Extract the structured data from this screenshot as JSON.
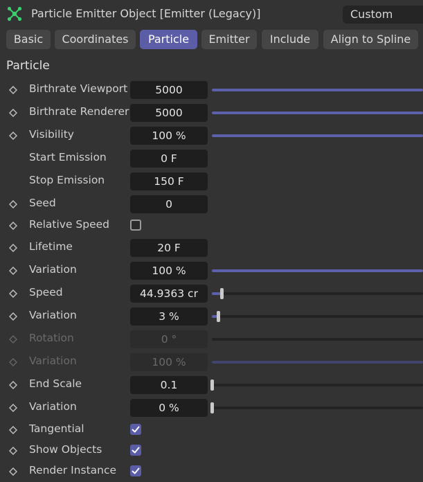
{
  "header": {
    "title": "Particle Emitter Object [Emitter (Legacy)]",
    "mode": "Custom",
    "icon": "particle-emitter-icon"
  },
  "tabs": [
    {
      "label": "Basic",
      "active": false
    },
    {
      "label": "Coordinates",
      "active": false
    },
    {
      "label": "Particle",
      "active": true
    },
    {
      "label": "Emitter",
      "active": false
    },
    {
      "label": "Include",
      "active": false
    },
    {
      "label": "Align to Spline",
      "active": false
    }
  ],
  "section": {
    "title": "Particle"
  },
  "params": [
    {
      "label": "Birthrate Viewport",
      "value": "5000",
      "keyframe": true,
      "slider": 1.0
    },
    {
      "label": "Birthrate Renderer",
      "value": "5000",
      "keyframe": true,
      "slider": 1.0
    },
    {
      "label": "Visibility",
      "value": "100 %",
      "keyframe": true,
      "slider": 1.0
    },
    {
      "label": "Start Emission",
      "value": "0 F",
      "keyframe": false
    },
    {
      "label": "Stop Emission",
      "value": "150 F",
      "keyframe": false
    },
    {
      "label": "Seed",
      "value": "0",
      "keyframe": true
    },
    {
      "label": "Relative Speed",
      "keyframe": true,
      "checkbox": false
    },
    {
      "label": "Lifetime",
      "value": "20 F",
      "keyframe": true
    },
    {
      "label": "Variation",
      "value": "100 %",
      "keyframe": true,
      "slider": 1.0
    },
    {
      "label": "Speed",
      "value": "44.9363 cr",
      "keyframe": true,
      "slider": 0.045,
      "knob": true
    },
    {
      "label": "Variation",
      "value": "3 %",
      "keyframe": true,
      "slider": 0.03,
      "knob": true
    },
    {
      "label": "Rotation",
      "value": "0 °",
      "keyframe": true,
      "disabled": true,
      "slider": 0
    },
    {
      "label": "Variation",
      "value": "100 %",
      "keyframe": true,
      "disabled": true,
      "slider": 1.0
    },
    {
      "label": "End Scale",
      "value": "0.1",
      "keyframe": true,
      "slider": 0,
      "knob": true
    },
    {
      "label": "Variation",
      "value": "0 %",
      "keyframe": true,
      "slider": 0,
      "knob": true
    },
    {
      "label": "Tangential",
      "keyframe": true,
      "checkbox": true
    },
    {
      "label": "Show Objects",
      "keyframe": true,
      "checkbox": true
    },
    {
      "label": "Render Instance",
      "keyframe": true,
      "checkbox": true
    }
  ],
  "colors": {
    "accent": "#5b5ea6",
    "background": "#333333",
    "field": "#1e1e1e",
    "icon_green": "#3ccf6e"
  }
}
